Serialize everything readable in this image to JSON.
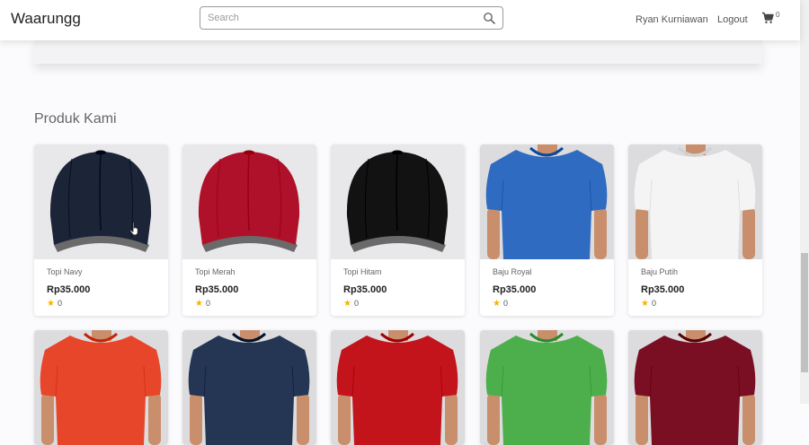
{
  "header": {
    "brand": "Waarungg",
    "search_placeholder": "Search",
    "user_name": "Ryan Kurniawan",
    "logout_label": "Logout",
    "cart_count": "0",
    "search_icon": "search-icon",
    "cart_icon": "cart-icon"
  },
  "main": {
    "section_title": "Produk Kami",
    "products": [
      {
        "name": "Topi Navy",
        "price": "Rp35.000",
        "rating": "0",
        "type": "cap",
        "color": "#1c2438"
      },
      {
        "name": "Topi Merah",
        "price": "Rp35.000",
        "rating": "0",
        "type": "cap",
        "color": "#b0112a"
      },
      {
        "name": "Topi Hitam",
        "price": "Rp35.000",
        "rating": "0",
        "type": "cap",
        "color": "#121212"
      },
      {
        "name": "Baju Royal",
        "price": "Rp35.000",
        "rating": "0",
        "type": "shirt",
        "color": "#2f6bc0"
      },
      {
        "name": "Baju Putih",
        "price": "Rp35.000",
        "rating": "0",
        "type": "shirt",
        "color": "#f4f4f4"
      },
      {
        "name": "",
        "price": "",
        "rating": "",
        "type": "shirt",
        "color": "#e8462a"
      },
      {
        "name": "",
        "price": "",
        "rating": "",
        "type": "shirt",
        "color": "#243653"
      },
      {
        "name": "",
        "price": "",
        "rating": "",
        "type": "shirt",
        "color": "#c3141c"
      },
      {
        "name": "",
        "price": "",
        "rating": "",
        "type": "shirt",
        "color": "#4caf4c"
      },
      {
        "name": "",
        "price": "",
        "rating": "",
        "type": "shirt",
        "color": "#7a0f24"
      }
    ]
  },
  "colors": {
    "star": "#f5b301",
    "accent_text": "#222222"
  }
}
